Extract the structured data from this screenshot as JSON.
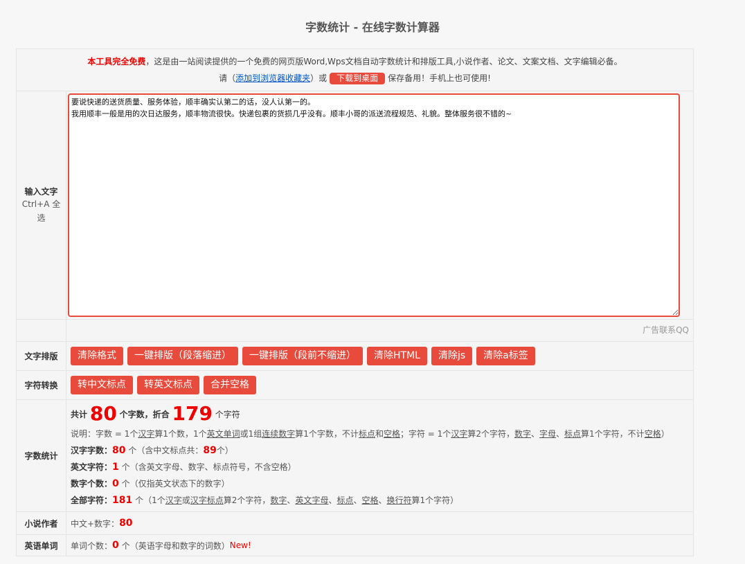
{
  "page": {
    "title": "字数统计 - 在线字数计算器"
  },
  "intro": {
    "free": "本工具完全免费",
    "text1": "，这是由一站阅读提供的一个免费的网页版Word,Wps文档自动字数统计和排版工具,小说作者、论文、文案文档、文字编辑必备。",
    "please": "请（",
    "bookmark_link": "添加到浏览器收藏夹",
    "or": "）或",
    "download": "下载到桌面",
    "tail": "保存备用！手机上也可使用!"
  },
  "input": {
    "label": "输入文字",
    "hint": "Ctrl+A 全选",
    "text": "要说快递的送货质量、服务体验，顺丰确实认第二的话，没人认第一的。\n我用顺丰一般是用的次日达服务，顺丰物流很快。快递包裹的货损几乎没有。顺丰小哥的派送流程规范、礼貌。整体服务很不错的~\n"
  },
  "ad": {
    "text": "广告联系QQ"
  },
  "layout": {
    "label": "文字排版",
    "buttons": [
      "清除格式",
      "一键排版（段落缩进）",
      "一键排版（段前不缩进）",
      "清除HTML",
      "清除js",
      "清除a标签"
    ]
  },
  "convert": {
    "label": "字符转换",
    "buttons": [
      "转中文标点",
      "转英文标点",
      "合并空格"
    ]
  },
  "stats": {
    "label": "字数统计",
    "total_pre": "共计",
    "total_words": "80",
    "total_mid": "个字数，折合",
    "total_chars": "179",
    "total_post": "个字符",
    "explain": {
      "a": "说明：字数 = 1个",
      "hanzi": "汉字",
      "b": "算1个数，1个",
      "word": "英文单词",
      "c": "或1组",
      "digits": "连续数字",
      "d": "算1个字数，不计",
      "punct": "标点",
      "e": "和",
      "space": "空格",
      "f": "；字符 = 1个",
      "hanzi2": "汉字",
      "g": "算2个字符，",
      "num": "数字",
      "sep1": "、",
      "letter": "字母",
      "sep2": "、",
      "punct2": "标点",
      "h": "算1个字符，不计",
      "space2": "空格",
      "i": "）"
    },
    "cn_label": "汉字字数：",
    "cn_value": "80",
    "cn_mid": "个（含中文标点共：",
    "cn_punct": "89",
    "cn_tail": "个）",
    "en_label": "英文字符：",
    "en_value": "1",
    "en_tail": "个（含英文字母、数字、标点符号，不含空格）",
    "num_label": "数字个数：",
    "num_value": "0",
    "num_tail": "个（仅指英文状态下的数字）",
    "all_label": "全部字符：",
    "all_value": "181",
    "all_a": "个（1个",
    "all_hanzi": "汉字",
    "all_or": "或",
    "all_cnpunct": "汉字标点",
    "all_b": "算2个字符，",
    "all_num": "数字",
    "all_s1": "、",
    "all_letter": "英文字母",
    "all_s2": "、",
    "all_punct": "标点",
    "all_s3": "、",
    "all_space": "空格",
    "all_s4": "、",
    "all_newline": "换行符",
    "all_c": "算1个字符）"
  },
  "novel": {
    "label": "小说作者",
    "text": "中文+数字：",
    "value": "80"
  },
  "english": {
    "label": "英语单词",
    "text": "单词个数：",
    "value": "0",
    "tail": "个（英语字母和数字的词数）",
    "new": "New!"
  }
}
